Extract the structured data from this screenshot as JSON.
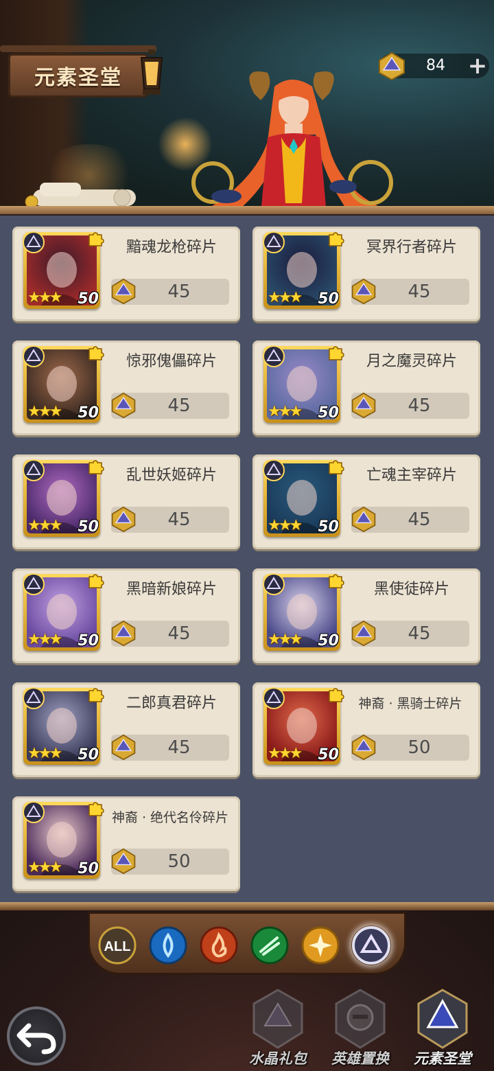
{
  "header": {
    "title": "元素圣堂",
    "currency": {
      "amount": "84",
      "add_label": "+"
    }
  },
  "items": [
    {
      "name": "黯魂龙枪碎片",
      "stars": "★★★",
      "level": "50",
      "price": "45",
      "art": [
        "#a02a2a",
        "#3a1a2a"
      ]
    },
    {
      "name": "冥界行者碎片",
      "stars": "★★★",
      "level": "50",
      "price": "45",
      "art": [
        "#2a4a6a",
        "#1a1a3a"
      ]
    },
    {
      "name": "惊邪傀儡碎片",
      "stars": "★★★",
      "level": "50",
      "price": "45",
      "art": [
        "#3a2a22",
        "#a06a4a"
      ]
    },
    {
      "name": "月之魔灵碎片",
      "stars": "★★★",
      "level": "50",
      "price": "45",
      "art": [
        "#5a6aa0",
        "#9a8ac8"
      ]
    },
    {
      "name": "乱世妖姬碎片",
      "stars": "★★★",
      "level": "50",
      "price": "45",
      "art": [
        "#4a2a6a",
        "#b06ac0"
      ]
    },
    {
      "name": "亡魂主宰碎片",
      "stars": "★★★",
      "level": "50",
      "price": "45",
      "art": [
        "#1a3a5a",
        "#2a5a7a"
      ]
    },
    {
      "name": "黑暗新娘碎片",
      "stars": "★★★",
      "level": "50",
      "price": "45",
      "art": [
        "#6a4aa0",
        "#c0a0e0"
      ]
    },
    {
      "name": "黑使徒碎片",
      "stars": "★★★",
      "level": "50",
      "price": "45",
      "art": [
        "#4a4a8a",
        "#d8d0e8"
      ]
    },
    {
      "name": "二郎真君碎片",
      "stars": "★★★",
      "level": "50",
      "price": "45",
      "art": [
        "#3a3a5a",
        "#a0a0c0"
      ]
    },
    {
      "name": "神裔 · 黑骑士碎片",
      "stars": "★★★",
      "level": "50",
      "price": "50",
      "art": [
        "#8a1a1a",
        "#e06a4a"
      ]
    },
    {
      "name": "神裔 · 绝代名伶碎片",
      "stars": "★★★",
      "level": "50",
      "price": "50",
      "art": [
        "#4a2a5a",
        "#e8c8c8"
      ]
    }
  ],
  "filters": [
    {
      "id": "all",
      "label": "ALL",
      "color": "#4a3a2a",
      "selected": false
    },
    {
      "id": "water",
      "label": "",
      "color": "#1a6ac0",
      "selected": false
    },
    {
      "id": "fire",
      "label": "",
      "color": "#c0401a",
      "selected": false
    },
    {
      "id": "wind",
      "label": "",
      "color": "#1a8a3a",
      "selected": false
    },
    {
      "id": "light",
      "label": "",
      "color": "#e09a20",
      "selected": false
    },
    {
      "id": "dark",
      "label": "",
      "color": "#3a3a5a",
      "selected": true
    }
  ],
  "nav": {
    "back_label": "",
    "items": [
      {
        "label": "水晶礼包",
        "active": false
      },
      {
        "label": "英雄置换",
        "active": false
      },
      {
        "label": "元素圣堂",
        "active": true
      }
    ]
  },
  "colors": {
    "star": "#ffd630",
    "card_bg": "#ece3d2",
    "list_bg": "#4a5166"
  }
}
